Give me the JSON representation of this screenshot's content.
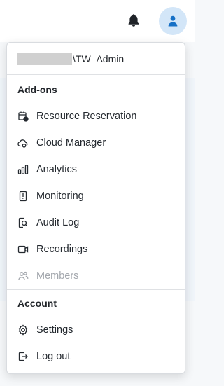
{
  "header": {
    "bell_icon": "bell-icon",
    "avatar_icon": "user-icon",
    "avatar_bg": "#d3e6f8",
    "avatar_color": "#1670c6"
  },
  "menu": {
    "user_suffix": "\\TW_Admin",
    "addons": {
      "title": "Add-ons",
      "items": [
        {
          "label": "Resource Reservation",
          "icon": "calendar-clock-icon",
          "enabled": true
        },
        {
          "label": "Cloud Manager",
          "icon": "cloud-settings-icon",
          "enabled": true
        },
        {
          "label": "Analytics",
          "icon": "bar-chart-icon",
          "enabled": true
        },
        {
          "label": "Monitoring",
          "icon": "clipboard-icon",
          "enabled": true
        },
        {
          "label": "Audit Log",
          "icon": "document-search-icon",
          "enabled": true
        },
        {
          "label": "Recordings",
          "icon": "video-icon",
          "enabled": true
        },
        {
          "label": "Members",
          "icon": "people-icon",
          "enabled": false
        }
      ]
    },
    "account": {
      "title": "Account",
      "items": [
        {
          "label": "Settings",
          "icon": "gear-icon",
          "enabled": true
        },
        {
          "label": "Log out",
          "icon": "logout-icon",
          "enabled": true
        }
      ]
    }
  }
}
